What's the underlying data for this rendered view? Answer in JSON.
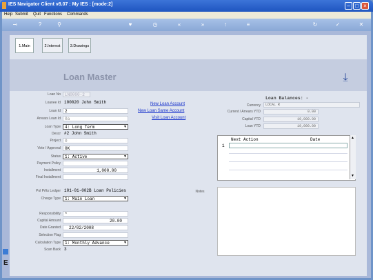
{
  "titlebar": {
    "title": "IES Navigator Client v8.07 : My IES :     [mode:2]"
  },
  "menu": [
    "Help",
    "Submit",
    "Quit",
    "Functions",
    "Commands"
  ],
  "tabs": [
    {
      "label": "1.Main"
    },
    {
      "label": "2.Interest"
    },
    {
      "label": "3.Drawings"
    }
  ],
  "heading": "Loan Master",
  "fields": {
    "loan_no": {
      "label": "Loan No",
      "value": "LN0000-2"
    },
    "loanee_id": {
      "label": "Loanee Id",
      "value": "100020 John Smith"
    },
    "loan_id": {
      "label": "Loan Id",
      "value": "2"
    },
    "arrears_loan_id": {
      "label": "Arrears Loan Id",
      "value": "0a"
    },
    "loan_type": {
      "label": "Loan Type",
      "value": "4: Long Term"
    },
    "descr": {
      "label": "Descr",
      "value": "#2 John Smith"
    },
    "project": {
      "label": "Project",
      "value": "0"
    },
    "vote_approval": {
      "label": "Vote / Approval",
      "value": "0K"
    },
    "status": {
      "label": "Status",
      "value": "1: Active"
    },
    "payment_policy": {
      "label": "Payment Policy",
      "value": ""
    },
    "installment": {
      "label": "Installment",
      "value": "1,000.00"
    },
    "final_installment": {
      "label": "Final Installment",
      "value": ""
    },
    "pol_prfts_ledger": {
      "label": "Pol Prfts Ledger",
      "value": "101-01-002B Loan Policies"
    },
    "charge_type": {
      "label": "Charge Type",
      "value": "1: Main Loan"
    },
    "responsibility": {
      "label": "Responsibility",
      "value": "*"
    },
    "capital_amount": {
      "label": "Capital Amount",
      "value": "20.00"
    },
    "date_granted": {
      "label": "Date Granted",
      "value": "22/02/2008"
    },
    "selection_flag": {
      "label": "Selection Flag",
      "value": ""
    },
    "calculation_type": {
      "label": "Calculation Type",
      "value": "1: Monthly Advance"
    },
    "scan_back": {
      "label": "Scan Back",
      "value": "3"
    }
  },
  "links": [
    "New Loan Account",
    "New Loan Same Account",
    "Visit Loan Account"
  ],
  "balances": {
    "title": "Loan Balances: -",
    "currency": {
      "label": "Currency",
      "value": "LOCAL R"
    },
    "current_arrears_ytd": {
      "label": "Current / Arrears YTD",
      "value": "0.00"
    },
    "capital_ytd": {
      "label": "Capital YTD",
      "value": "19,000.00"
    },
    "loan_ytd": {
      "label": "Loan YTD",
      "value": "19,000.00"
    }
  },
  "grid": {
    "col_next_action": "Next Action",
    "col_date": "Date",
    "row1_num": "1"
  },
  "notes_label": "Notes"
}
